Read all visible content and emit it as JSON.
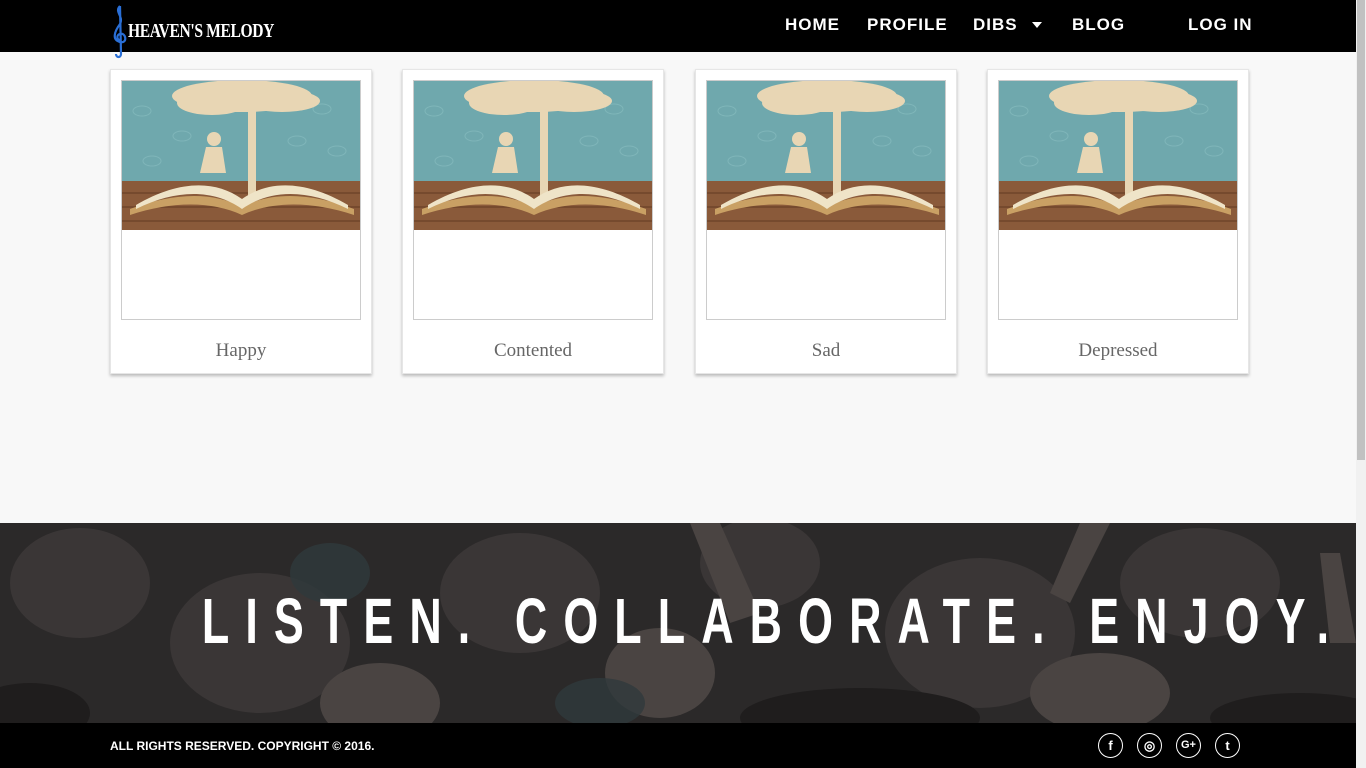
{
  "brand": {
    "name": "HEAVEN'S MELODY"
  },
  "nav": {
    "home": "HOME",
    "profile": "PROFILE",
    "dibs": "DIBS",
    "blog": "BLOG",
    "login": "LOG IN"
  },
  "moods": [
    {
      "label": "Happy"
    },
    {
      "label": "Contented"
    },
    {
      "label": "Sad"
    },
    {
      "label": "Depressed"
    }
  ],
  "hero": {
    "tagline": "LISTEN. COLLABORATE. ENJOY."
  },
  "footer": {
    "copyright": "ALL RIGHTS RESERVED. COPYRIGHT © 2016.",
    "social": [
      {
        "icon": "facebook-icon",
        "glyph": "f"
      },
      {
        "icon": "dribbble-icon",
        "glyph": "◎"
      },
      {
        "icon": "google-plus-icon",
        "glyph": "G+"
      },
      {
        "icon": "twitter-icon",
        "glyph": "t"
      }
    ]
  },
  "colors": {
    "navbar": "#000000",
    "footer": "#000000",
    "page_bg": "#f8f8f8",
    "card_label": "#666666",
    "logo_accent": "#2a6fd6"
  }
}
